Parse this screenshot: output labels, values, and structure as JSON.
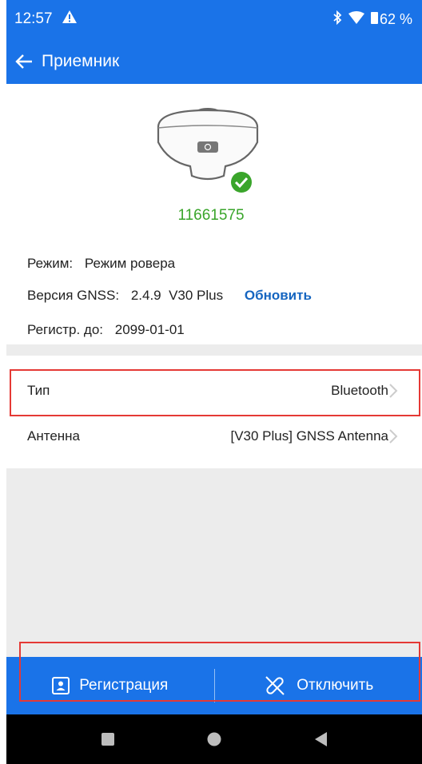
{
  "status_bar": {
    "time": "12:57",
    "battery": "62 %",
    "icons": [
      "alert-triangle-icon",
      "bluetooth-icon",
      "wifi-icon",
      "battery-icon"
    ]
  },
  "app_bar": {
    "title": "Приемник",
    "back_icon": "arrow-left-icon"
  },
  "device": {
    "image": "gnss-receiver-image",
    "status_icon": "check-circle-icon",
    "serial": "11661575"
  },
  "info": {
    "mode_label": "Режим:",
    "mode_value": "Режим ровера",
    "gnss_label": "Версия GNSS:",
    "gnss_value": "2.4.9  V30 Plus",
    "update_label": "Обновить",
    "reg_label": "Регистр. до:",
    "reg_value": "2099-01-01"
  },
  "settings": [
    {
      "label": "Тип",
      "value": "Bluetooth"
    },
    {
      "label": "Антенна",
      "value": "[V30 Plus] GNSS Antenna"
    }
  ],
  "bottom_bar": {
    "register_label": "Регистрация",
    "disconnect_label": "Отключить"
  },
  "colors": {
    "accent": "#1a73e8",
    "serial_green": "#3aa52b",
    "link_blue": "#1565c0",
    "highlight_red": "#e53935"
  }
}
